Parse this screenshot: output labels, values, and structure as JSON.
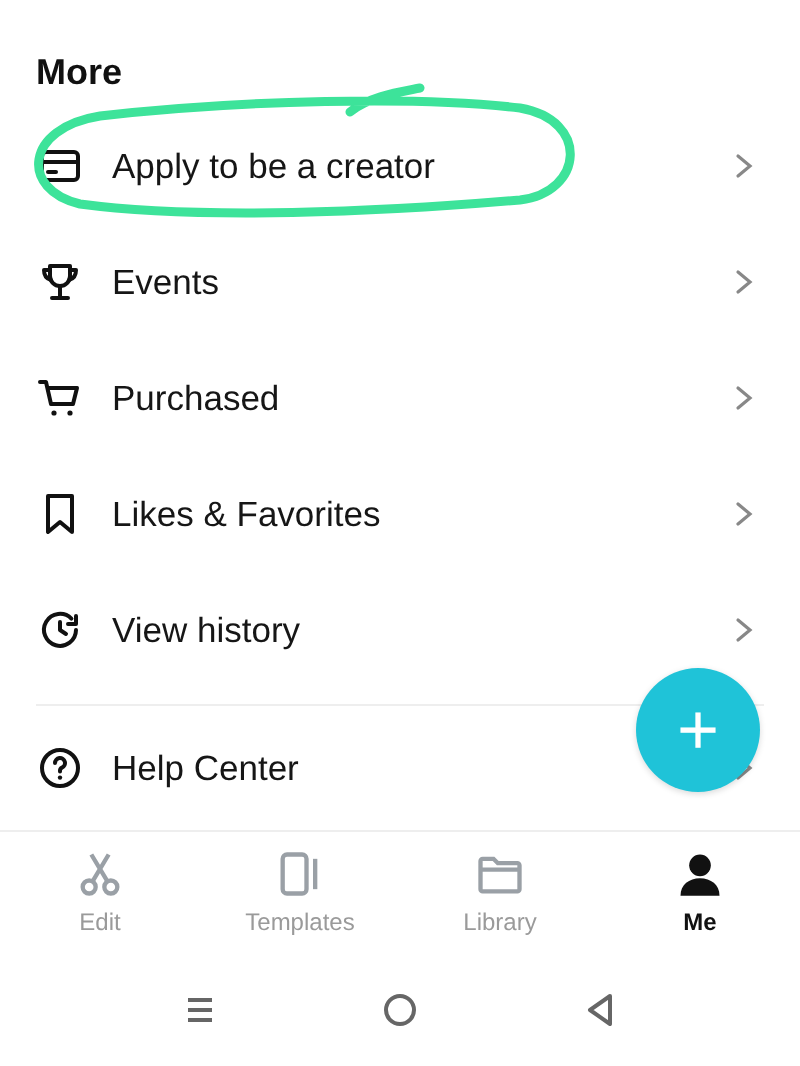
{
  "section_title": "More",
  "groups": [
    [
      {
        "kind": "card",
        "label": "Apply to be a creator",
        "highlighted": true
      },
      {
        "kind": "trophy",
        "label": "Events",
        "highlighted": false
      },
      {
        "kind": "cart",
        "label": "Purchased",
        "highlighted": false
      },
      {
        "kind": "bookmark",
        "label": "Likes & Favorites",
        "highlighted": false
      },
      {
        "kind": "history",
        "label": "View history",
        "highlighted": false
      }
    ],
    [
      {
        "kind": "help",
        "label": "Help Center",
        "highlighted": false
      }
    ]
  ],
  "fab": {
    "label": "+"
  },
  "tabs": [
    {
      "kind": "edit",
      "label": "Edit",
      "selected": false
    },
    {
      "kind": "templates",
      "label": "Templates",
      "selected": false
    },
    {
      "kind": "library",
      "label": "Library",
      "selected": false
    },
    {
      "kind": "me",
      "label": "Me",
      "selected": true
    }
  ],
  "system_nav": [
    {
      "kind": "recents"
    },
    {
      "kind": "home"
    },
    {
      "kind": "back"
    }
  ]
}
